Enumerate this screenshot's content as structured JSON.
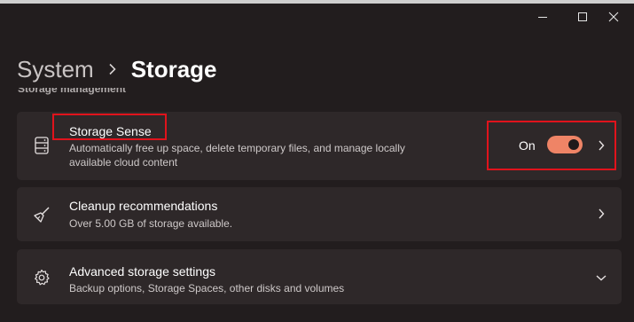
{
  "window": {
    "controls": [
      "minimize",
      "maximize",
      "close"
    ]
  },
  "breadcrumb": {
    "parent": "System",
    "separator_icon": "chevron-right-icon",
    "current": "Storage"
  },
  "section": {
    "heading": "Storage management"
  },
  "cards": {
    "storage_sense": {
      "icon": "storage-drive-icon",
      "title": "Storage Sense",
      "description_line1": "Automatically free up space, delete temporary files, and manage locally",
      "description_line2": "available cloud content",
      "toggle_label": "On",
      "toggle_on": true,
      "chevron": "chevron-right-icon"
    },
    "cleanup": {
      "icon": "broom-icon",
      "title": "Cleanup recommendations",
      "description": "Over 5.00 GB of storage available.",
      "chevron": "chevron-right-icon"
    },
    "advanced": {
      "icon": "gear-icon",
      "title": "Advanced storage settings",
      "description": "Backup options, Storage Spaces, other disks and volumes",
      "chevron": "chevron-down-icon"
    }
  },
  "colors": {
    "background": "#221d1e",
    "card": "#2e2829",
    "accent_toggle": "#ef8466",
    "highlight": "#e0131c"
  }
}
